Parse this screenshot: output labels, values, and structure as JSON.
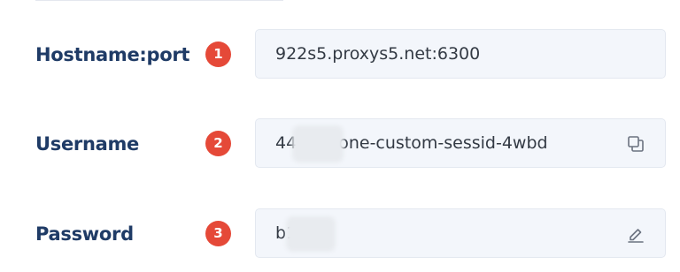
{
  "fields": [
    {
      "label": "Hostname:port",
      "step": "1",
      "value": "922s5.proxys5.net:6300",
      "icon": null
    },
    {
      "label": "Username",
      "step": "2",
      "value": "44      63-zone-custom-sessid-4wbd",
      "icon": "copy-icon"
    },
    {
      "label": "Password",
      "step": "3",
      "value": "b1      CM",
      "icon": "edit-icon"
    }
  ],
  "colors": {
    "label": "#1f3b66",
    "badge": "#e54938",
    "field_bg": "#f3f6fb",
    "value_text": "#333a44"
  }
}
